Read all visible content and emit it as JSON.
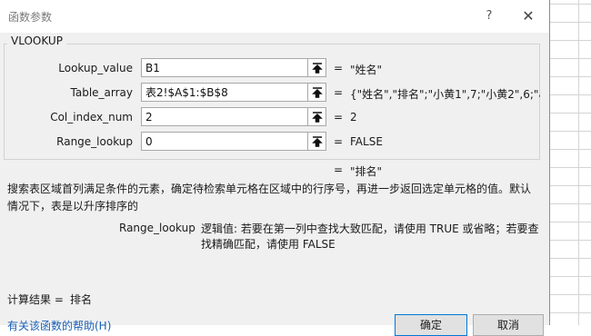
{
  "dialog": {
    "title": "函数参数",
    "help_label": "?",
    "close_label": "✕"
  },
  "function": {
    "name": "VLOOKUP",
    "arguments": [
      {
        "label": "Lookup_value",
        "value": "B1",
        "result": "\"姓名\""
      },
      {
        "label": "Table_array",
        "value": "表2!$A$1:$B$8",
        "result": "{\"姓名\",\"排名\";\"小黄1\",7;\"小黄2\",6;\"小"
      },
      {
        "label": "Col_index_num",
        "value": "2",
        "result": "2"
      },
      {
        "label": "Range_lookup",
        "value": "0",
        "result": "FALSE"
      }
    ],
    "equals_sign": "=",
    "overall_result": "\"排名\"",
    "description": "搜索表区域首列满足条件的元素，确定待检索单元格在区域中的行序号，再进一步返回选定单元格的值。默认情况下，表是以升序排序的",
    "param_name": "Range_lookup",
    "param_description": "逻辑值: 若要在第一列中查找大致匹配，请使用 TRUE 或省略；若要查找精确匹配，请使用 FALSE"
  },
  "calc": {
    "label": "计算结果 =",
    "value": "排名"
  },
  "footer": {
    "help_link": "有关该函数的帮助(H)",
    "ok_label": "确定",
    "cancel_label": "取消"
  }
}
